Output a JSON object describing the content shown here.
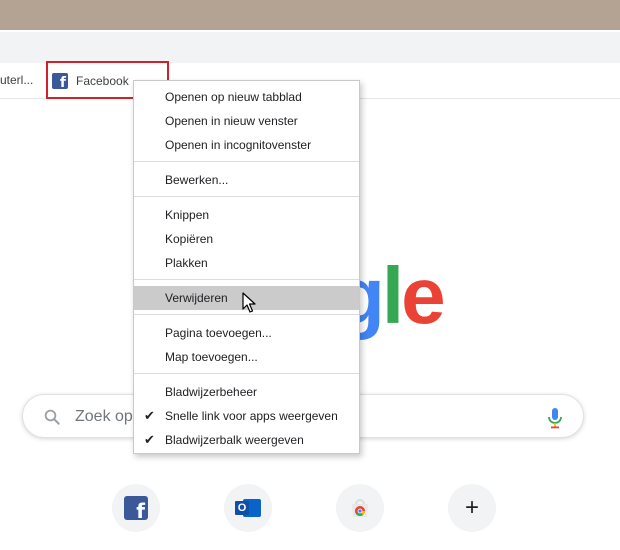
{
  "bookmarks_bar": {
    "truncated_label": "uterl...",
    "facebook_label": "Facebook"
  },
  "search": {
    "placeholder": "Zoek op"
  },
  "shortcuts": [
    {
      "icon": "facebook-icon"
    },
    {
      "icon": "outlook-icon"
    },
    {
      "icon": "chrome-web-store-icon"
    },
    {
      "icon": "plus-icon"
    }
  ],
  "context_menu": {
    "open_new_tab": "Openen op nieuw tabblad",
    "open_new_window": "Openen in nieuw venster",
    "open_incognito": "Openen in incognitovenster",
    "edit": "Bewerken...",
    "cut": "Knippen",
    "copy": "Kopiëren",
    "paste": "Plakken",
    "delete": "Verwijderen",
    "add_page": "Pagina toevoegen...",
    "add_folder": "Map toevoegen...",
    "bookmark_manager": "Bladwijzerbeheer",
    "show_apps_shortcut": "Snelle link voor apps weergeven",
    "show_bookmarks_bar": "Bladwijzerbalk weergeven"
  },
  "colors": {
    "title_bar": "#b4a392",
    "highlight_box": "#d0202a",
    "menu_hover": "#cbcbcb",
    "google_blue": "#4285f4",
    "google_green": "#34a853",
    "google_red": "#ea4335"
  }
}
